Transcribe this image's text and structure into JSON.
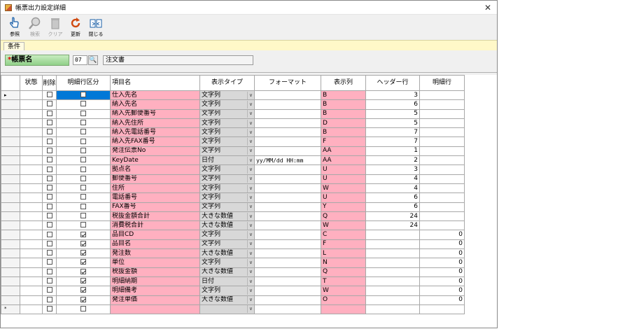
{
  "window": {
    "title": "帳票出力設定詳細",
    "close_glyph": "✕"
  },
  "toolbar": {
    "buttons": [
      {
        "label": "参照",
        "icon": "hand-pointer-icon",
        "enabled": true
      },
      {
        "label": "検索",
        "icon": "search-icon",
        "enabled": false
      },
      {
        "label": "クリア",
        "icon": "trash-icon",
        "enabled": false
      },
      {
        "label": "更新",
        "icon": "refresh-icon",
        "enabled": true
      },
      {
        "label": "閉じる",
        "icon": "close-door-icon",
        "enabled": true
      }
    ]
  },
  "tab": {
    "label": "条件"
  },
  "condition": {
    "required_mark": "*",
    "field_label": "帳票名",
    "code_value": "07",
    "search_glyph": "🔍",
    "name_value": "注文書"
  },
  "grid": {
    "headers": [
      "状態",
      "削除",
      "明細行区分",
      "項目名",
      "表示タイプ",
      "フォーマット",
      "表示列",
      "ヘッダー行",
      "明細行"
    ],
    "current_row_glyph": "▸",
    "new_row_glyph": "*",
    "rows": [
      {
        "del": false,
        "detail": false,
        "name": "仕入先名",
        "type": "文字列",
        "format": "",
        "col": "B",
        "header_row": "3",
        "detail_row": ""
      },
      {
        "del": false,
        "detail": false,
        "name": "納入先名",
        "type": "文字列",
        "format": "",
        "col": "B",
        "header_row": "6",
        "detail_row": ""
      },
      {
        "del": false,
        "detail": false,
        "name": "納入先郵便番号",
        "type": "文字列",
        "format": "",
        "col": "B",
        "header_row": "5",
        "detail_row": ""
      },
      {
        "del": false,
        "detail": false,
        "name": "納入先住所",
        "type": "文字列",
        "format": "",
        "col": "D",
        "header_row": "5",
        "detail_row": ""
      },
      {
        "del": false,
        "detail": false,
        "name": "納入先電話番号",
        "type": "文字列",
        "format": "",
        "col": "B",
        "header_row": "7",
        "detail_row": ""
      },
      {
        "del": false,
        "detail": false,
        "name": "納入先FAX番号",
        "type": "文字列",
        "format": "",
        "col": "F",
        "header_row": "7",
        "detail_row": ""
      },
      {
        "del": false,
        "detail": false,
        "name": "発注伝票No",
        "type": "文字列",
        "format": "",
        "col": "AA",
        "header_row": "1",
        "detail_row": ""
      },
      {
        "del": false,
        "detail": false,
        "name": "KeyDate",
        "type": "日付",
        "format": "yy/MM/dd HH:mm",
        "col": "AA",
        "header_row": "2",
        "detail_row": ""
      },
      {
        "del": false,
        "detail": false,
        "name": "拠点名",
        "type": "文字列",
        "format": "",
        "col": "U",
        "header_row": "3",
        "detail_row": ""
      },
      {
        "del": false,
        "detail": false,
        "name": "郵便番号",
        "type": "文字列",
        "format": "",
        "col": "U",
        "header_row": "4",
        "detail_row": ""
      },
      {
        "del": false,
        "detail": false,
        "name": "住所",
        "type": "文字列",
        "format": "",
        "col": "W",
        "header_row": "4",
        "detail_row": ""
      },
      {
        "del": false,
        "detail": false,
        "name": "電話番号",
        "type": "文字列",
        "format": "",
        "col": "U",
        "header_row": "6",
        "detail_row": ""
      },
      {
        "del": false,
        "detail": false,
        "name": "FAX番号",
        "type": "文字列",
        "format": "",
        "col": "Y",
        "header_row": "6",
        "detail_row": ""
      },
      {
        "del": false,
        "detail": false,
        "name": "税抜金額合計",
        "type": "大きな数値",
        "format": "",
        "col": "Q",
        "header_row": "24",
        "detail_row": ""
      },
      {
        "del": false,
        "detail": false,
        "name": "消費税合計",
        "type": "大きな数値",
        "format": "",
        "col": "W",
        "header_row": "24",
        "detail_row": ""
      },
      {
        "del": false,
        "detail": true,
        "name": "品目CD",
        "type": "文字列",
        "format": "",
        "col": "C",
        "header_row": "",
        "detail_row": "0"
      },
      {
        "del": false,
        "detail": true,
        "name": "品目名",
        "type": "文字列",
        "format": "",
        "col": "F",
        "header_row": "",
        "detail_row": "0"
      },
      {
        "del": false,
        "detail": true,
        "name": "発注数",
        "type": "大きな数値",
        "format": "",
        "col": "L",
        "header_row": "",
        "detail_row": "0"
      },
      {
        "del": false,
        "detail": true,
        "name": "単位",
        "type": "文字列",
        "format": "",
        "col": "N",
        "header_row": "",
        "detail_row": "0"
      },
      {
        "del": false,
        "detail": true,
        "name": "税抜金額",
        "type": "大きな数値",
        "format": "",
        "col": "Q",
        "header_row": "",
        "detail_row": "0"
      },
      {
        "del": false,
        "detail": true,
        "name": "明細納期",
        "type": "日付",
        "format": "",
        "col": "T",
        "header_row": "",
        "detail_row": "0"
      },
      {
        "del": false,
        "detail": true,
        "name": "明細備考",
        "type": "文字列",
        "format": "",
        "col": "W",
        "header_row": "",
        "detail_row": "0"
      },
      {
        "del": false,
        "detail": true,
        "name": "発注単価",
        "type": "大きな数値",
        "format": "",
        "col": "O",
        "header_row": "",
        "detail_row": "0"
      }
    ]
  },
  "colors": {
    "required_pink": "#ffb0c0",
    "tab_strip": "#fff8c8",
    "selection": "#0078d7"
  }
}
